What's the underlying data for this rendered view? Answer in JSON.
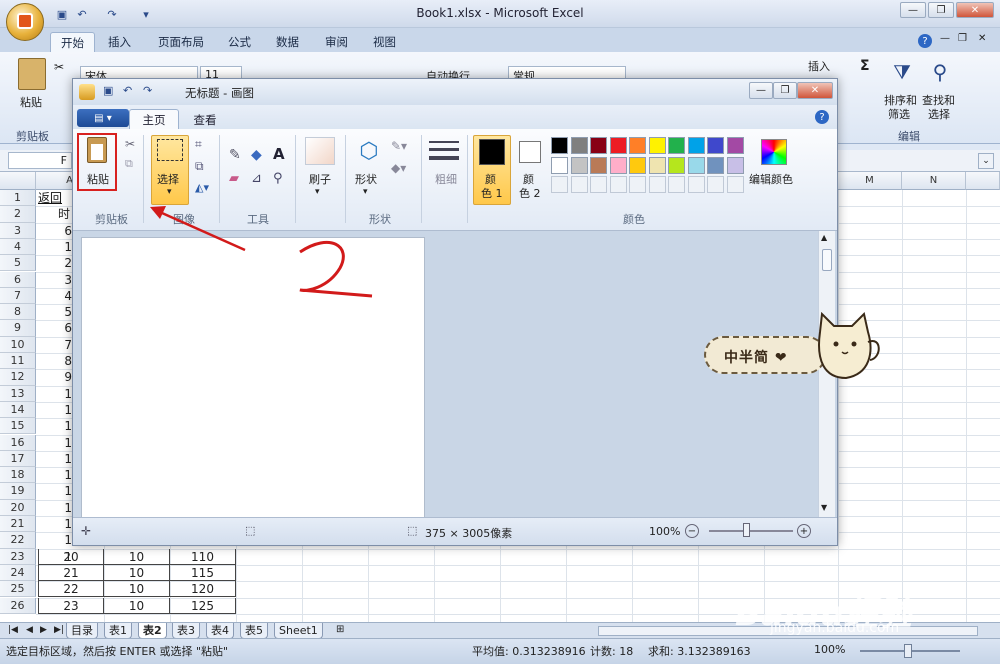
{
  "excel": {
    "title": "Book1.xlsx - Microsoft Excel",
    "tabs": [
      "开始",
      "插入",
      "页面布局",
      "公式",
      "数据",
      "审阅",
      "视图"
    ],
    "ribbon": {
      "paste": "粘贴",
      "clipboard_group": "剪贴板",
      "font_name": "宋体",
      "font_size": "11",
      "wrap_text": "自动换行",
      "number_format": "常规",
      "insert": "插入",
      "sort_filter_1": "排序和",
      "sort_filter_2": "筛选",
      "find_select_1": "查找和",
      "find_select_2": "选择",
      "editing_group": "编辑"
    },
    "name_box": "F",
    "columns": [
      "A",
      "M",
      "N"
    ],
    "rows": [
      "1",
      "2",
      "3",
      "4",
      "5",
      "6",
      "7",
      "8",
      "9",
      "10",
      "11",
      "12",
      "13",
      "14",
      "15",
      "16",
      "17",
      "18",
      "19",
      "20",
      "21",
      "22",
      "23",
      "24",
      "25",
      "26"
    ],
    "cells_partial": {
      "a1": "返回",
      "a2": "时"
    },
    "partial_col_a": [
      "6",
      "1",
      "2",
      "3",
      "4",
      "5",
      "6",
      "7",
      "8",
      "9",
      "1",
      "1",
      "1",
      "1",
      "1",
      "1",
      "1",
      "1",
      "1",
      "1",
      "1"
    ],
    "table_rows": [
      [
        "20",
        "10",
        "110"
      ],
      [
        "21",
        "10",
        "115"
      ],
      [
        "22",
        "10",
        "120"
      ],
      [
        "23",
        "10",
        "125"
      ]
    ],
    "sheets": [
      "目录",
      "表1",
      "表2",
      "表3",
      "表4",
      "表5",
      "Sheet1"
    ],
    "status": {
      "message": "选定目标区域，然后按 ENTER 或选择 \"粘贴\"",
      "average": "平均值: 0.313238916",
      "count": "计数: 18",
      "sum": "求和: 3.132389163",
      "zoom": "100%"
    }
  },
  "paint": {
    "title": "无标题 - 画图",
    "tabs": {
      "home": "主页",
      "view": "查看"
    },
    "paste": "粘贴",
    "clipboard_group": "剪贴板",
    "select": "选择",
    "image_group": "图像",
    "tools_group": "工具",
    "brush": "刷子",
    "shapes": "形状",
    "shapes_group": "形状",
    "size": "粗细",
    "color1_a": "颜",
    "color1_b": "色 1",
    "color2_a": "颜",
    "color2_b": "色 2",
    "edit_colors": "编辑颜色",
    "colors_group": "颜色",
    "palette_row1": [
      "#000000",
      "#7f7f7f",
      "#880015",
      "#ed1c24",
      "#ff7f27",
      "#fff200",
      "#22b14c",
      "#00a2e8",
      "#3f48cc",
      "#a349a4"
    ],
    "palette_row2": [
      "#ffffff",
      "#c3c3c3",
      "#b97a57",
      "#ffaec9",
      "#ffc90e",
      "#efe4b0",
      "#b5e61d",
      "#99d9ea",
      "#7092be",
      "#c8bfe7"
    ],
    "dimensions": "375 × 3005像素",
    "zoom": "100%"
  },
  "annotation": {
    "number": "2"
  },
  "sticker": {
    "text": "中半简 ❤"
  },
  "watermark": {
    "brand": "Baidu经验",
    "url": "jingyan.baidu.com"
  }
}
